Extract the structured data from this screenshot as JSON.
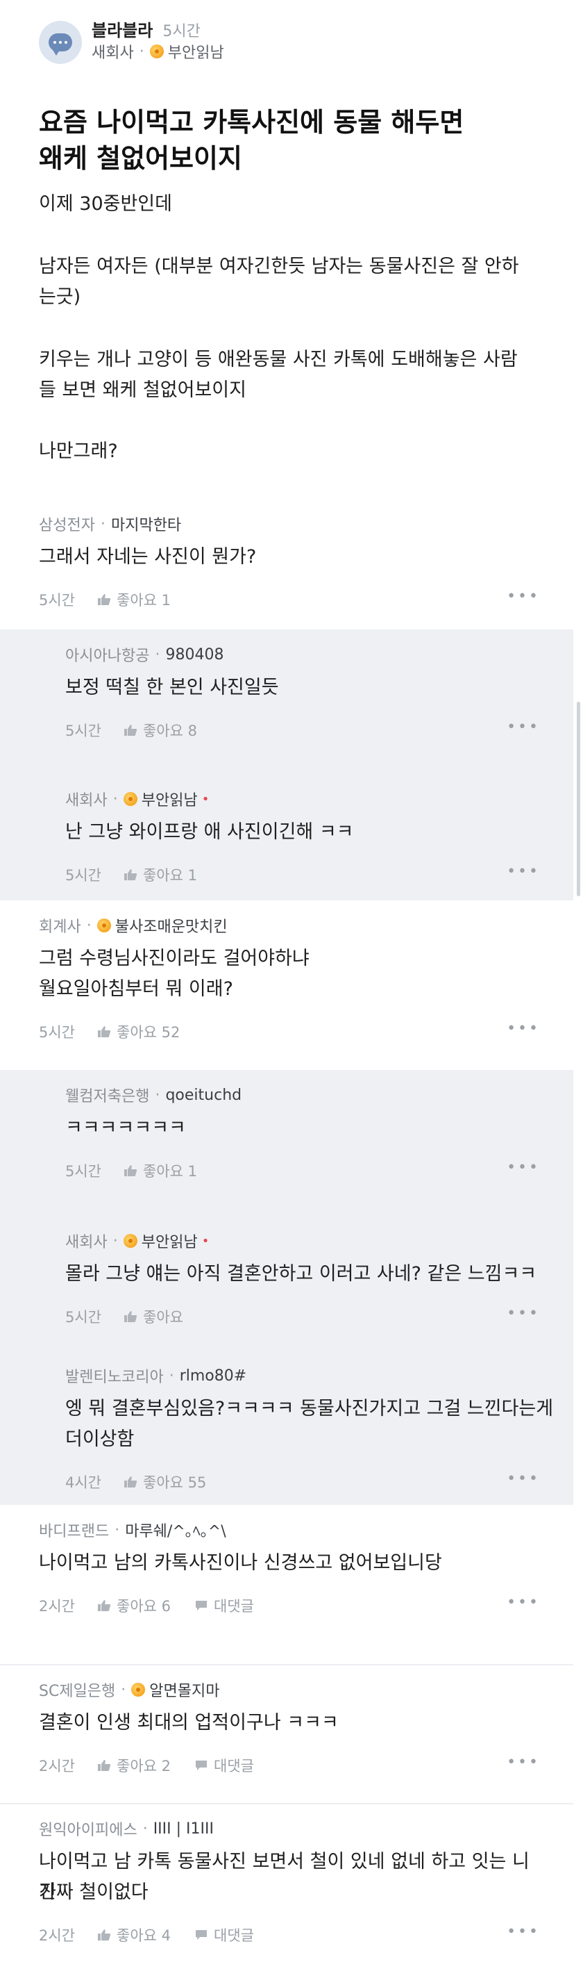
{
  "post": {
    "board": "블라블라",
    "time": "5시간",
    "company": "새회사",
    "nickname": "부안읽남",
    "title_line1": "요즘 나이먹고 카톡사진에 동물 해두면",
    "title_line2": "왜케 철없어보이지",
    "body": [
      "이제 30중반인데",
      "남자든 여자든 (대부분 여자긴한듯 남자는 동물사진은 잘 안하",
      "는긋)",
      "키우는 개나 고양이 등 애완동물 사진 카톡에 도배해놓은 사람",
      "들 보면 왜케 철없어보이지",
      "나만그래?"
    ]
  },
  "comments": [
    {
      "company": "삼성전자",
      "nick": "마지막한타",
      "badge": false,
      "lines": [
        "그래서 자네는 사진이 뭔가?"
      ],
      "time": "5시간",
      "likes": "좋아요 1",
      "reply": ""
    },
    {
      "company": "아시아나항공",
      "nick": "980408",
      "badge": false,
      "lines": [
        "보정 떡칠 한 본인 사진일듯"
      ],
      "time": "5시간",
      "likes": "좋아요 8",
      "reply": ""
    },
    {
      "company": "새회사",
      "nick": "부안읽남",
      "badge": true,
      "red": "•",
      "lines": [
        "난 그냥 와이프랑 애 사진이긴해 ㅋㅋ"
      ],
      "time": "5시간",
      "likes": "좋아요 1",
      "reply": ""
    },
    {
      "company": "회계사",
      "nick": "불사조매운맛치킨",
      "badge": true,
      "lines": [
        "그럼 수령님사진이라도 걸어야하냐",
        "월요일아침부터 뭐 이래?"
      ],
      "time": "5시간",
      "likes": "좋아요 52",
      "reply": ""
    },
    {
      "company": "웰컴저축은행",
      "nick": "qoeituchd",
      "badge": false,
      "lines": [
        "ㅋㅋㅋㅋㅋㅋㅋ"
      ],
      "time": "5시간",
      "likes": "좋아요 1",
      "reply": ""
    },
    {
      "company": "새회사",
      "nick": "부안읽남",
      "badge": true,
      "red": "•",
      "lines": [
        "몰라 그냥 얘는 아직 결혼안하고 이러고 사네? 같은 느낌ㅋㅋ"
      ],
      "time": "5시간",
      "likes": "좋아요",
      "reply": ""
    },
    {
      "company": "발렌티노코리아",
      "nick": "rlmo80#",
      "badge": false,
      "lines": [
        "엥 뭐 결혼부심있음?ㅋㅋㅋㅋ 동물사진가지고 그걸 느낀다는게",
        "더이상함"
      ],
      "time": "4시간",
      "likes": "좋아요 55",
      "reply": ""
    },
    {
      "company": "바디프랜드",
      "nick": "마루쉐/^｡ﾍ｡^\\",
      "badge": false,
      "lines": [
        "나이먹고 남의 카톡사진이나 신경쓰고 없어보입니당"
      ],
      "time": "2시간",
      "likes": "좋아요 6",
      "reply": "대댓글"
    },
    {
      "company": "SC제일은행",
      "nick": "알면몰지마",
      "badge": true,
      "lines": [
        "결혼이 인생 최대의 업적이구나 ㅋㅋㅋ"
      ],
      "time": "2시간",
      "likes": "좋아요 2",
      "reply": "대댓글"
    },
    {
      "company": "원익아이피에스",
      "nick": "IIII | I1III",
      "badge": false,
      "lines": [
        "나이먹고 남 카톡 동물사진 보면서 철이 있네 없네 하고 잇는 니가",
        "진짜 철이없다"
      ],
      "time": "2시간",
      "likes": "좋아요 4",
      "reply": "대댓글"
    }
  ],
  "ui": {
    "more": "•••",
    "sep": "·"
  }
}
